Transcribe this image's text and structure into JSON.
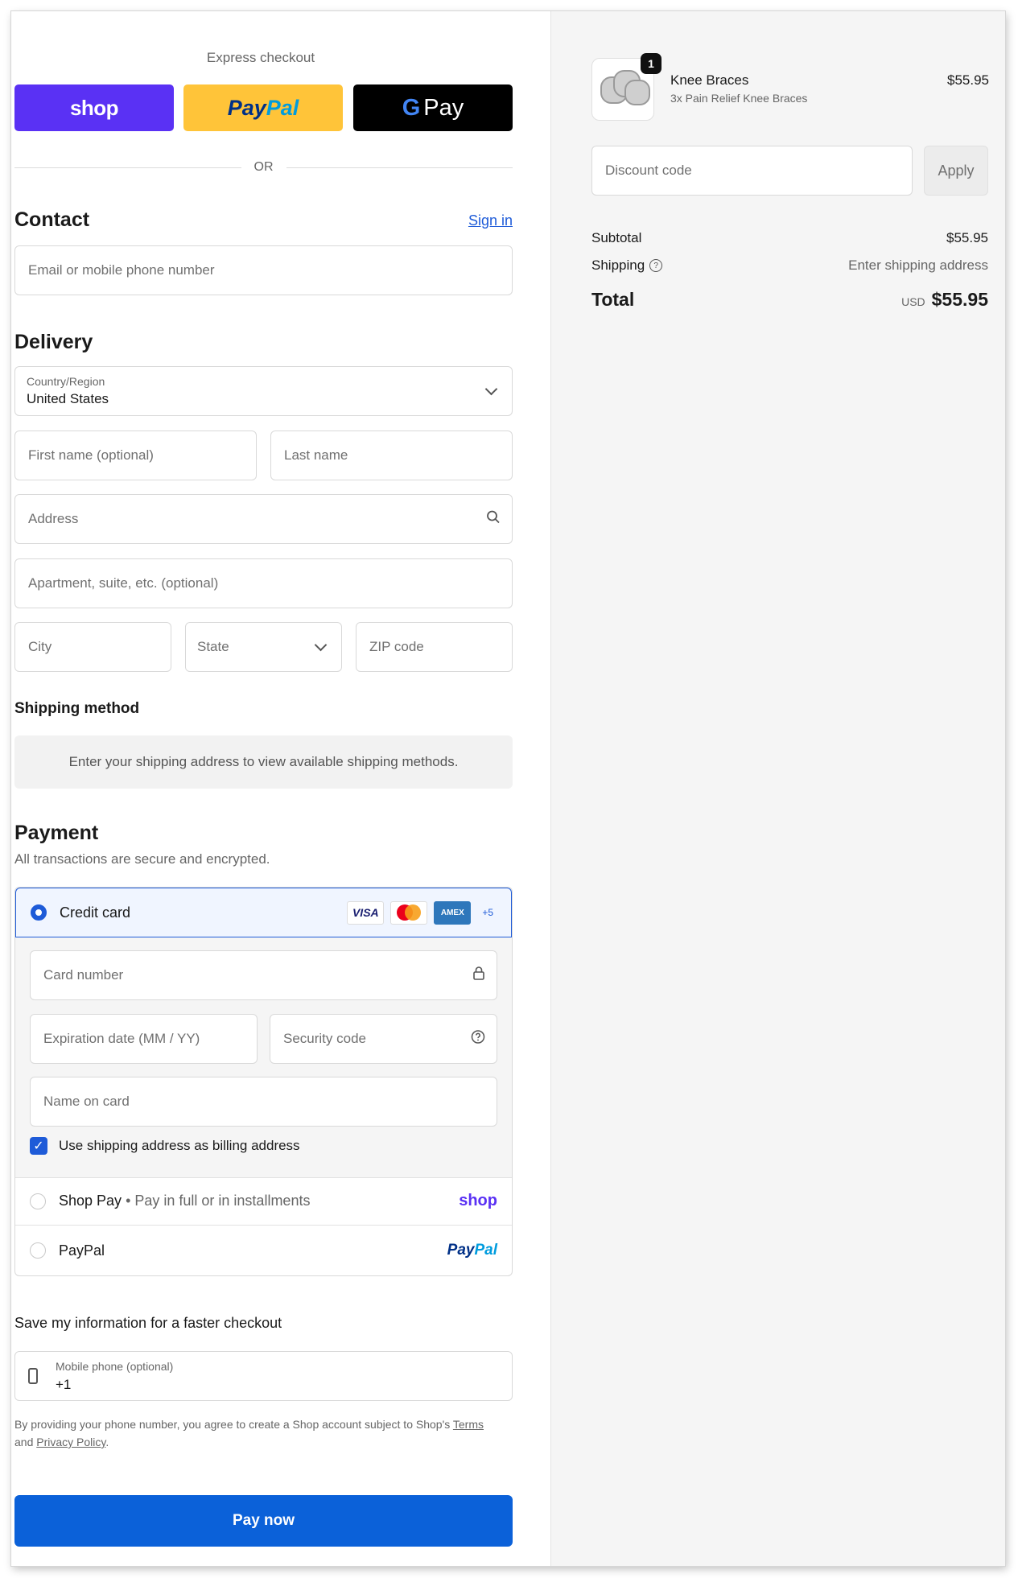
{
  "express": {
    "title": "Express checkout",
    "shop_label": "shop",
    "paypal_label_a": "Pay",
    "paypal_label_b": "Pal",
    "gpay_g": "G",
    "gpay_label": "Pay",
    "or": "OR"
  },
  "contact": {
    "heading": "Contact",
    "signin": "Sign in",
    "email_placeholder": "Email or mobile phone number"
  },
  "delivery": {
    "heading": "Delivery",
    "country_label": "Country/Region",
    "country_value": "United States",
    "first_name_placeholder": "First name (optional)",
    "last_name_placeholder": "Last name",
    "address_placeholder": "Address",
    "apartment_placeholder": "Apartment, suite, etc. (optional)",
    "city_placeholder": "City",
    "state_value": "State",
    "zip_placeholder": "ZIP code"
  },
  "shipping_method": {
    "heading": "Shipping method",
    "info": "Enter your shipping address to view available shipping methods."
  },
  "payment": {
    "heading": "Payment",
    "subtitle": "All transactions are secure and encrypted.",
    "credit_card_label": "Credit card",
    "card_logos": {
      "visa": "VISA",
      "amex": "AMEX",
      "more": "+5"
    },
    "card_number_placeholder": "Card number",
    "expiration_placeholder": "Expiration date (MM / YY)",
    "security_placeholder": "Security code",
    "name_placeholder": "Name on card",
    "billing_checkbox_label": "Use shipping address as billing address",
    "shop_pay_label": "Shop Pay",
    "shop_pay_sub": " • Pay in full or in installments",
    "shop_brand": "shop",
    "paypal_label": "PayPal",
    "paypal_brand_a": "Pay",
    "paypal_brand_b": "Pal"
  },
  "save": {
    "title": "Save my information for a faster checkout",
    "phone_label": "Mobile phone (optional)",
    "phone_value": "+1",
    "legal_a": "By providing your phone number, you agree to create a Shop account subject to Shop's ",
    "terms": "Terms",
    "legal_and": "and ",
    "privacy": "Privacy Policy",
    "legal_end": "."
  },
  "pay_now": "Pay now",
  "summary": {
    "quantity": "1",
    "product_name": "Knee Braces",
    "product_sub": "3x Pain Relief Knee Braces",
    "product_price": "$55.95",
    "discount_placeholder": "Discount code",
    "apply": "Apply",
    "subtotal_label": "Subtotal",
    "subtotal_value": "$55.95",
    "shipping_label": "Shipping",
    "shipping_value": "Enter shipping address",
    "total_label": "Total",
    "currency": "USD",
    "total_value": "$55.95"
  },
  "colors": {
    "accent": "#1e5bd8",
    "shop_purple": "#5a31f4",
    "paypal_yellow": "#ffc439",
    "pay_now_blue": "#0b61d9"
  }
}
